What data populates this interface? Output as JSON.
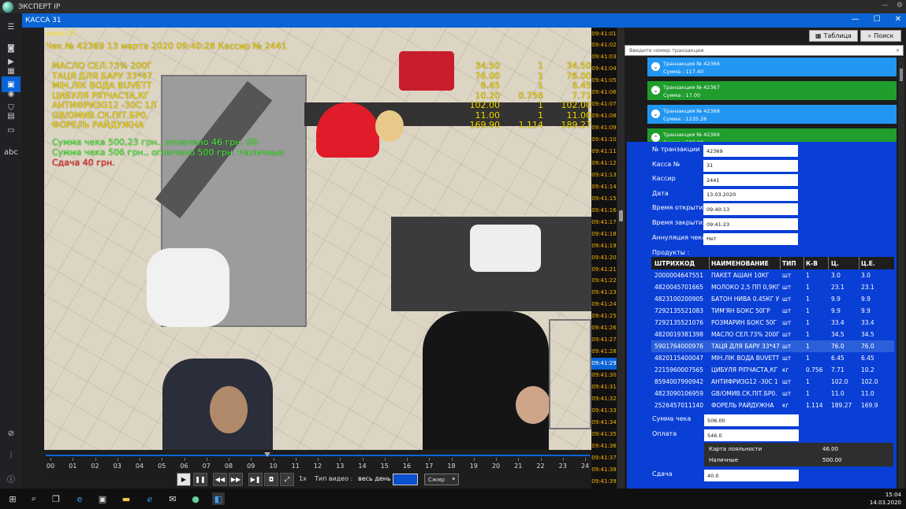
{
  "app": {
    "title": "ЭКСПЕРТ IP"
  },
  "window": {
    "title": "КАССА 31"
  },
  "overlay": {
    "camera": "касса 31",
    "header": "Чек № 42369  13 марта 2020 09:40:28  Кассир № 2441",
    "items": [
      {
        "name": "МАСЛО СЕЛ.73% 200Г",
        "price": "34.50",
        "qty": "1",
        "sum": "34.50"
      },
      {
        "name": "ТАЦЯ ДЛЯ БАРУ 33*47",
        "price": "76.00",
        "qty": "1",
        "sum": "76.00"
      },
      {
        "name": "МІН.ЛІК ВОДА BUVETT",
        "price": "6.45",
        "qty": "1",
        "sum": "6.45"
      },
      {
        "name": "ЦИБУЛЯ РІПЧАСТА,КГ",
        "price": "10.20",
        "qty": "0.756",
        "sum": "7.71"
      },
      {
        "name": "АНТИФРИЗG12 -30С 1Л",
        "price": "102.00",
        "qty": "1",
        "sum": "102.00"
      },
      {
        "name": "GB/ОМИВ.СК.ПІТ.БР0,",
        "price": "11.00",
        "qty": "1",
        "sum": "11.00"
      },
      {
        "name": "ФОРЕЛЬ РАЙДУЖНА",
        "price": "169.90",
        "qty": "1.114",
        "sum": "189.27"
      }
    ],
    "sum_line1": "Сумма чека 500,23 грн., оплачено 46 грн. 00",
    "sum_line2": "Сумма чека 506 грн., оплачено 500 грн. Наличные",
    "change": "Сдача 40 грн."
  },
  "timecol": [
    "09:41:01",
    "09:41:02",
    "09:41:03",
    "09:41:04",
    "09:41:05",
    "09:41:06",
    "09:41:07",
    "09:41:08",
    "09:41:09",
    "09:41:10",
    "09:41:11",
    "09:41:12",
    "09:41:13",
    "09:41:14",
    "09:41:15",
    "09:41:16",
    "09:41:17",
    "09:41:18",
    "09:41:19",
    "09:41:20",
    "09:41:21",
    "09:41:22",
    "09:41:23",
    "09:41:24",
    "09:41:25",
    "09:41:26",
    "09:41:27",
    "09:41:28",
    "09:41:29",
    "09:41:30",
    "09:41:31",
    "09:41:32",
    "09:41:33",
    "09:41:34",
    "09:41:35",
    "09:41:36",
    "09:41:37",
    "09:41:38",
    "09:41:39"
  ],
  "timecol_active": "09:41:29",
  "timeline": {
    "ticks": [
      "00",
      "01",
      "02",
      "03",
      "04",
      "05",
      "06",
      "07",
      "08",
      "09",
      "10",
      "11",
      "12",
      "13",
      "14",
      "15",
      "16",
      "17",
      "18",
      "19",
      "20",
      "21",
      "22",
      "23",
      "24"
    ],
    "position": 0.405
  },
  "controls": {
    "speed": "1x",
    "video_type_label": "Тип видео :",
    "video_type_value": "весь день",
    "mode": "Сжмр"
  },
  "panel": {
    "table_button": "Таблица",
    "search_button": "Поиск",
    "search_placeholder": "Введите номер транзакции",
    "transactions": [
      {
        "title": "Транзакция № 42366",
        "sum": "Сумма : 117.40",
        "color": "blue"
      },
      {
        "title": "Транзакция № 42367",
        "sum": "Сумма : 17.00",
        "color": "green"
      },
      {
        "title": "Транзакция № 42368",
        "sum": "Сумма : 1235.26",
        "color": "blue"
      },
      {
        "title": "Транзакция № 42369",
        "sum": "Сумма : 506.00",
        "color": "green"
      }
    ],
    "fields": [
      {
        "label": "№ транзакции",
        "value": "42369"
      },
      {
        "label": "Касса №",
        "value": "31"
      },
      {
        "label": "Кассир",
        "value": "2441"
      },
      {
        "label": "Дата",
        "value": "13.03.2020"
      },
      {
        "label": "Время открытия",
        "value": "09:40:13"
      },
      {
        "label": "Время закрытия",
        "value": "09:41:23"
      },
      {
        "label": "Аннуляция чека",
        "value": "Нет"
      }
    ],
    "products_label": "Продукты :",
    "columns": [
      "ШТРИХКОД",
      "НАИМЕНОВАНИЕ",
      "ТИП",
      "К-В",
      "Ц.",
      "Ц.Е."
    ],
    "products": [
      [
        "2000004647551",
        "ПАКЕТ АШАН 10КГ",
        "шт",
        "1",
        "3.0",
        "3.0"
      ],
      [
        "4820045701665",
        "МОЛОКО 2,5 ПП 0,9КГ",
        "шт",
        "1",
        "23.1",
        "23.1"
      ],
      [
        "4823100200905",
        "БАТОН НИВА 0.45КГ У",
        "шт",
        "1",
        "9.9",
        "9.9"
      ],
      [
        "7292135521083",
        "ТИМ'ЯН БОКС 50ГР",
        "шт",
        "1",
        "9.9",
        "9.9"
      ],
      [
        "7292135521076",
        "РОЗМАРИН БОКС 50Г",
        "шт",
        "1",
        "33.4",
        "33.4"
      ],
      [
        "4820019381398",
        "МАСЛО СЕЛ.73% 200Г",
        "шт",
        "1",
        "34.5",
        "34.5"
      ],
      [
        "5901764000976",
        "ТАЦЯ ДЛЯ БАРУ 33*47",
        "шт",
        "1",
        "76.0",
        "76.0"
      ],
      [
        "4820115400047",
        "МІН.ЛІК ВОДА BUVETT",
        "шт",
        "1",
        "6.45",
        "6.45"
      ],
      [
        "2215960007565",
        "ЦИБУЛЯ РІПЧАСТА,КГ",
        "кг",
        "0.756",
        "7.71",
        "10.2"
      ],
      [
        "8594007990942",
        "АНТИФРИЗG12 -30С 1",
        "шт",
        "1",
        "102.0",
        "102.0"
      ],
      [
        "4823090106959",
        "GB/ОМИВ.СК.ПІТ.БР0.",
        "шт",
        "1",
        "11.0",
        "11.0"
      ],
      [
        "2526457011140",
        "ФОРЕЛЬ РАЙДУЖНА",
        "кг",
        "1.114",
        "189.27",
        "169.9"
      ]
    ],
    "selected_row": 6,
    "check_sum_label": "Сумма чека",
    "check_sum_value": "506.00",
    "paid_label": "Оплата",
    "paid_value": "546.0",
    "loyalty_label": "Карта лояльности",
    "loyalty_value": "46.00",
    "cash_label": "Наличные",
    "cash_value": "500.00",
    "change_label": "Сдача",
    "change_value": "40.0"
  },
  "taskbar": {
    "time": "15:04",
    "date": "14.03.2020"
  }
}
